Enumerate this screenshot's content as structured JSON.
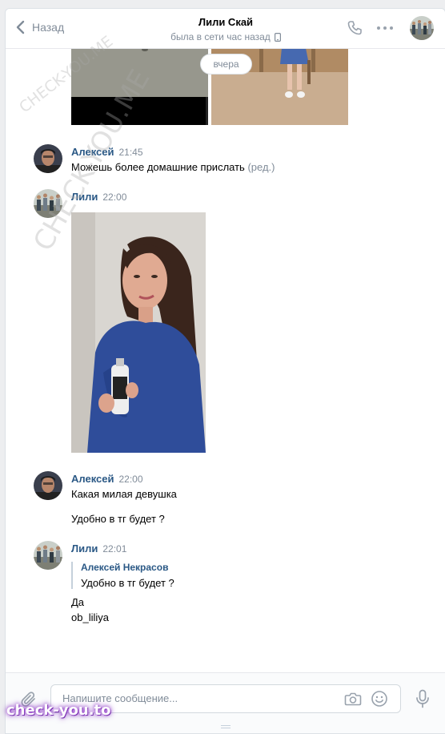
{
  "header": {
    "back_label": "Назад",
    "contact_name": "Лили Скай",
    "contact_status": "была в сети час назад"
  },
  "date_separator": "вчера",
  "messages": [
    {
      "author": "Алексей",
      "time": "21:45",
      "text": "Можешь более домашние прислать",
      "edited": "(ред.)"
    },
    {
      "author": "Лили",
      "time": "22:00"
    },
    {
      "author": "Алексей",
      "time": "22:00",
      "lines": [
        "Какая милая девушка",
        "Удобно в тг будет ?"
      ]
    },
    {
      "author": "Лили",
      "time": "22:01",
      "reply": {
        "author": "Алексей Некрасов",
        "text": "Удобно в тг будет ?"
      },
      "lines": [
        "Да",
        "ob_liliya"
      ]
    }
  ],
  "composer": {
    "placeholder": "Напишите сообщение..."
  },
  "watermark": {
    "corner": "check-you.to",
    "diagonal": "CHECK-YOU.ME"
  },
  "colors": {
    "link": "#2a5885",
    "muted": "#818c99",
    "accent": "#5181b8"
  }
}
